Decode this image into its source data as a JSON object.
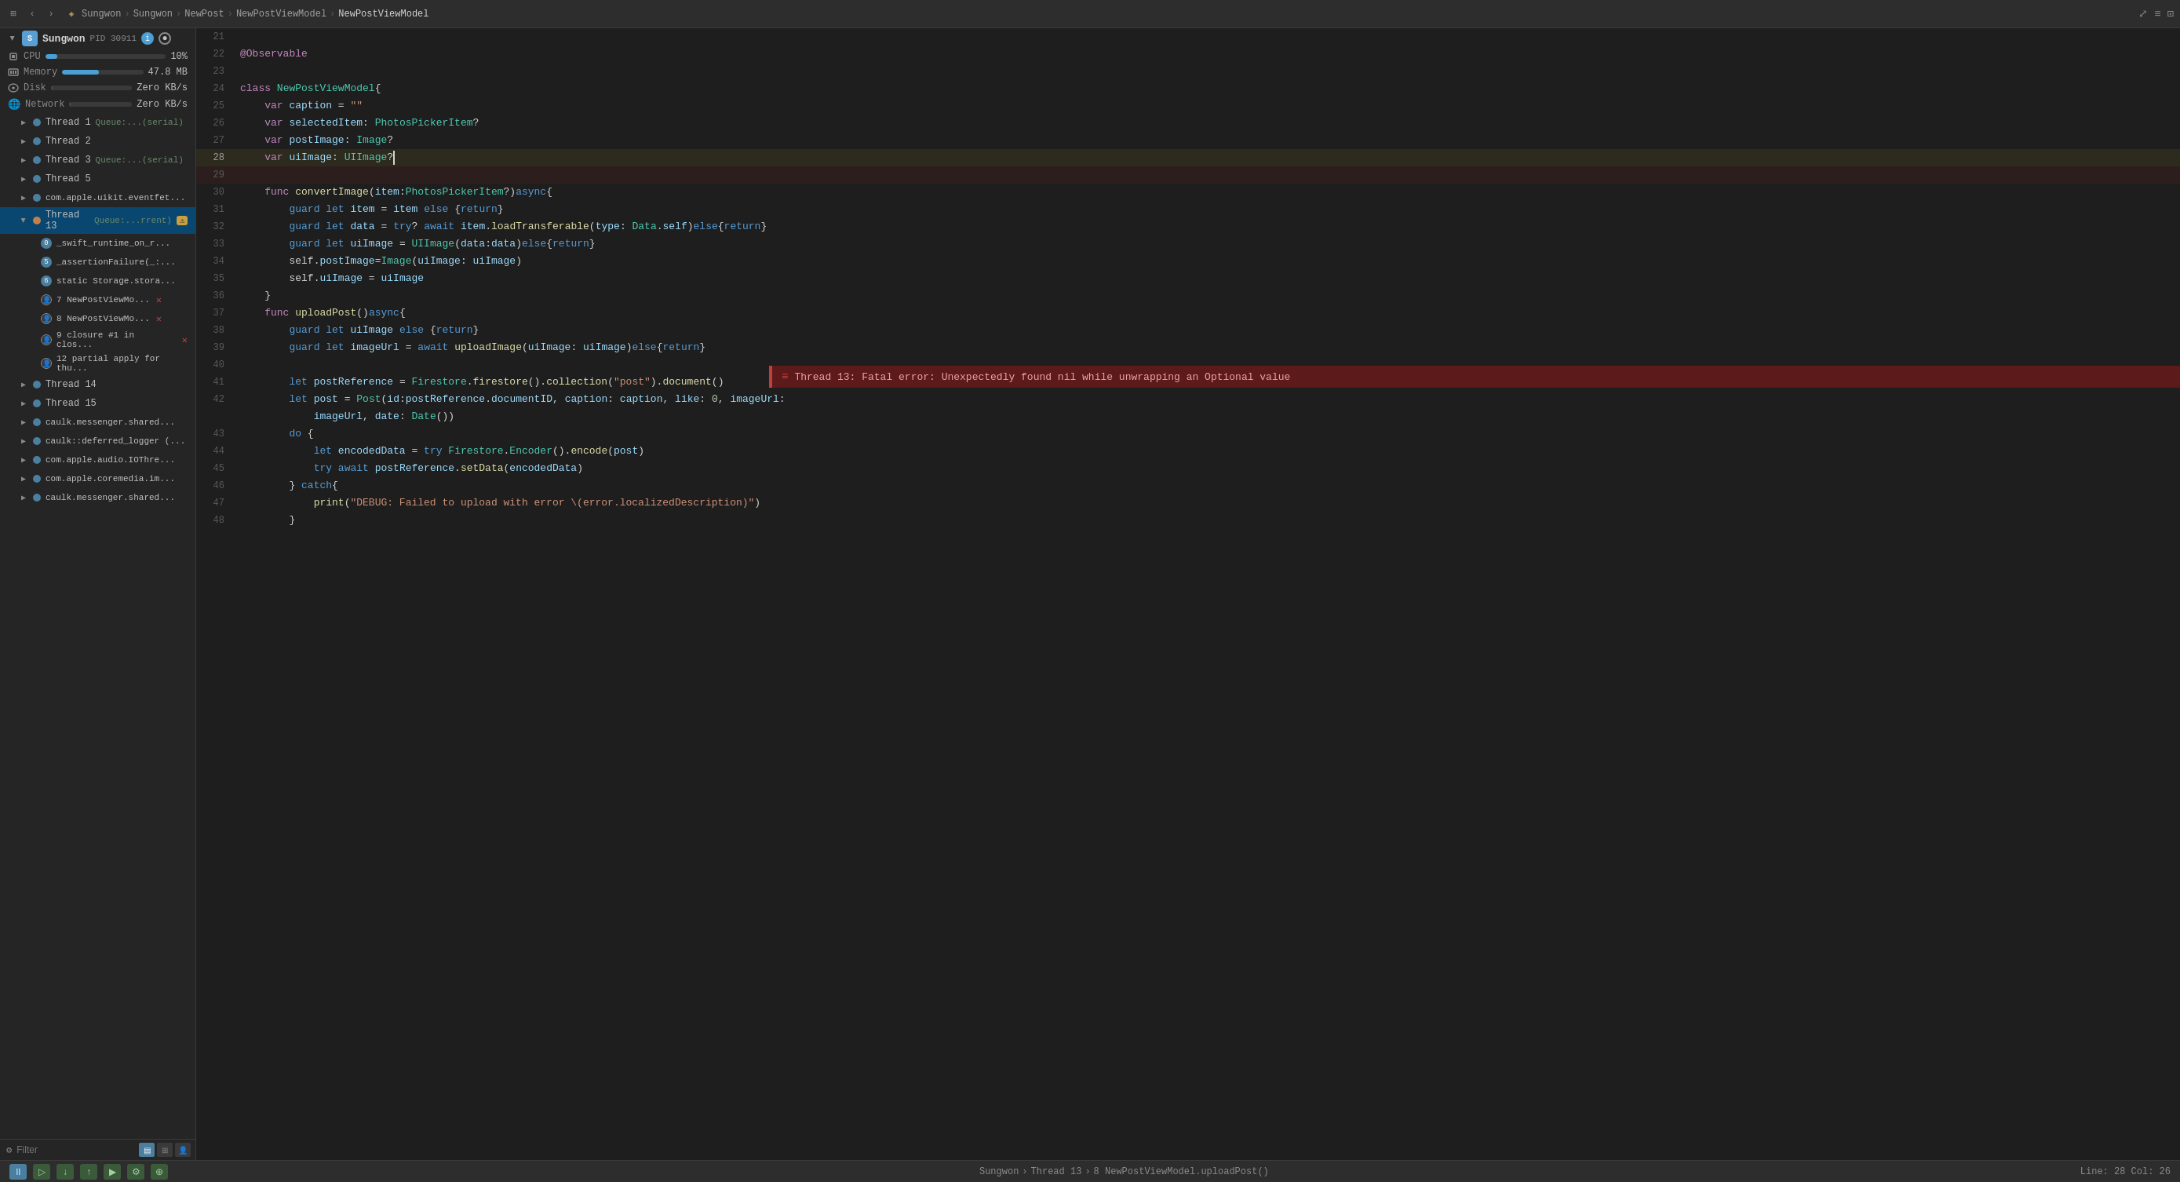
{
  "topBar": {
    "breadcrumbs": [
      {
        "label": "Sungwon",
        "type": "item"
      },
      {
        "label": ">",
        "type": "sep"
      },
      {
        "label": "Sungwon",
        "type": "item"
      },
      {
        "label": ">",
        "type": "sep"
      },
      {
        "label": "NewPost",
        "type": "item"
      },
      {
        "label": ">",
        "type": "sep"
      },
      {
        "label": "NewPostViewModel",
        "type": "item"
      },
      {
        "label": ">",
        "type": "sep"
      },
      {
        "label": "NewPostViewModel",
        "type": "active"
      }
    ]
  },
  "sidebar": {
    "app": {
      "name": "Sungwon",
      "pid": "PID 30911"
    },
    "metrics": [
      {
        "label": "CPU",
        "value": "10%",
        "type": "cpu"
      },
      {
        "label": "Memory",
        "value": "47.8 MB",
        "type": "memory"
      },
      {
        "label": "Disk",
        "value": "Zero KB/s",
        "type": "disk"
      },
      {
        "label": "Network",
        "value": "Zero KB/s",
        "type": "network"
      }
    ],
    "threads": [
      {
        "id": 1,
        "label": "Thread 1",
        "detail": "Queue:...(serial)",
        "expanded": false,
        "type": "normal"
      },
      {
        "id": 2,
        "label": "Thread 2",
        "detail": "",
        "expanded": false,
        "type": "normal"
      },
      {
        "id": 3,
        "label": "Thread 3",
        "detail": "Queue:...(serial)",
        "expanded": false,
        "type": "normal"
      },
      {
        "id": 5,
        "label": "Thread 5",
        "detail": "",
        "expanded": false,
        "type": "normal"
      },
      {
        "id": "com",
        "label": "com.apple.uikit.eventfet...",
        "detail": "",
        "expanded": false,
        "type": "normal"
      },
      {
        "id": 13,
        "label": "Thread 13",
        "detail": "Queue:...rrent)",
        "expanded": true,
        "type": "error",
        "warning": true,
        "subitems": [
          {
            "num": "0",
            "label": "_swift_runtime_on_r...",
            "type": "blue"
          },
          {
            "num": "5",
            "label": "_assertionFailure(_:...",
            "type": "blue"
          },
          {
            "num": "6",
            "label": "static Storage.stora...",
            "type": "blue"
          },
          {
            "num": "7",
            "label": "NewPostViewMo...",
            "type": "person",
            "icon": "cross"
          },
          {
            "num": "8",
            "label": "NewPostViewMo...",
            "type": "person",
            "icon": "cross"
          },
          {
            "num": "9",
            "label": "closure #1 in clos...",
            "type": "person",
            "icon": "cross"
          },
          {
            "num": "12",
            "label": "partial apply for thu...",
            "type": "person"
          }
        ]
      },
      {
        "id": 14,
        "label": "Thread 14",
        "detail": "",
        "expanded": false,
        "type": "normal"
      },
      {
        "id": 15,
        "label": "Thread 15",
        "detail": "",
        "expanded": false,
        "type": "normal"
      },
      {
        "id": "caulk1",
        "label": "caulk.messenger.shared...",
        "detail": "",
        "expanded": false,
        "type": "normal"
      },
      {
        "id": "caulk2",
        "label": "caulk::deferred_logger (...",
        "detail": "",
        "expanded": false,
        "type": "normal"
      },
      {
        "id": "com2",
        "label": "com.apple.audio.IOThre...",
        "detail": "",
        "expanded": false,
        "type": "normal"
      },
      {
        "id": "com3",
        "label": "com.apple.coremedia.im...",
        "detail": "",
        "expanded": false,
        "type": "normal"
      },
      {
        "id": "caulk3",
        "label": "caulk.messenger.shared...",
        "detail": "",
        "expanded": false,
        "type": "normal"
      }
    ],
    "filter": {
      "placeholder": "Filter"
    }
  },
  "codeEditor": {
    "lines": [
      {
        "num": 21,
        "content": ""
      },
      {
        "num": 22,
        "content": "@Observable"
      },
      {
        "num": 23,
        "content": ""
      },
      {
        "num": 24,
        "content": "class NewPostViewModel{"
      },
      {
        "num": 25,
        "content": "    var caption = \"\""
      },
      {
        "num": 26,
        "content": "    var selectedItem: PhotosPickerItem?"
      },
      {
        "num": 27,
        "content": "    var postImage: Image?"
      },
      {
        "num": 28,
        "content": "    var uiImage: UIImage?"
      },
      {
        "num": 29,
        "content": "",
        "hasError": true,
        "errorText": "Thread 13: Fatal error: Unexpectedly found nil while unwrapping an Optional value"
      },
      {
        "num": 30,
        "content": "    func convertImage(item:PhotosPickerItem?)async{"
      },
      {
        "num": 31,
        "content": "        guard let item = item else {return}"
      },
      {
        "num": 32,
        "content": "        guard let data = try? await item.loadTransferable(type: Data.self)else{return}"
      },
      {
        "num": 33,
        "content": "        guard let uiImage = UIImage(data:data)else{return}"
      },
      {
        "num": 34,
        "content": "        self.postImage=Image(uiImage: uiImage)"
      },
      {
        "num": 35,
        "content": "        self.uiImage = uiImage"
      },
      {
        "num": 36,
        "content": "    }"
      },
      {
        "num": 37,
        "content": "    func uploadPost()async{"
      },
      {
        "num": 38,
        "content": "        guard let uiImage else {return}"
      },
      {
        "num": 39,
        "content": "        guard let imageUrl = await uploadImage(uiImage: uiImage)else{return}"
      },
      {
        "num": 40,
        "content": ""
      },
      {
        "num": 41,
        "content": "        let postReference = Firestore.firestore().collection(\"post\").document()"
      },
      {
        "num": 42,
        "content": "        let post = Post(id:postReference.documentID, caption: caption, like: 0, imageUrl:"
      },
      {
        "num": 42.1,
        "content": "            imageUrl, date: Date())"
      },
      {
        "num": 43,
        "content": "        do {"
      },
      {
        "num": 44,
        "content": "            let encodedData = try Firestore.Encoder().encode(post)"
      },
      {
        "num": 45,
        "content": "            try await postReference.setData(encodedData)"
      },
      {
        "num": 46,
        "content": "        } catch{"
      },
      {
        "num": 47,
        "content": "            print(\"DEBUG: Failed to upload with error \\(error.localizedDescription)\")"
      },
      {
        "num": 48,
        "content": "        }"
      }
    ]
  },
  "statusBar": {
    "breadcrumb": [
      "Sungwon",
      ">",
      "Thread 13",
      ">",
      "8 NewPostViewModel.uploadPost()"
    ],
    "position": "Line: 28  Col: 26"
  },
  "errorPopup": {
    "text": "Thread 13: Fatal error: Unexpectedly found nil while unwrapping an Optional value"
  }
}
